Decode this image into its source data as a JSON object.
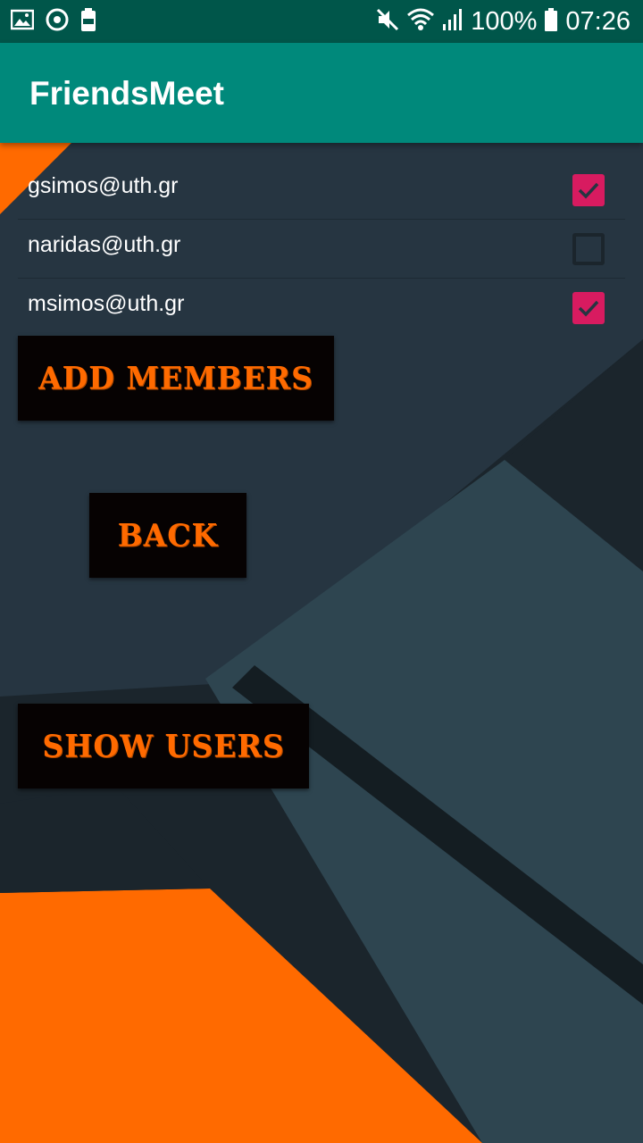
{
  "status_bar": {
    "battery_percent": "100%",
    "time": "07:26",
    "icons": [
      "gallery-icon",
      "sync-icon",
      "battery-saver-icon",
      "mute-icon",
      "wifi-icon",
      "signal-icon",
      "battery-icon"
    ]
  },
  "app_bar": {
    "title": "FriendsMeet"
  },
  "users": [
    {
      "email": "gsimos@uth.gr",
      "checked": true
    },
    {
      "email": "naridas@uth.gr",
      "checked": false
    },
    {
      "email": "msimos@uth.gr",
      "checked": true
    }
  ],
  "buttons": {
    "add_members": "ADD MEMBERS",
    "back": "BACK",
    "show_users": "SHOW USERS"
  },
  "colors": {
    "status_bar": "#00564a",
    "app_bar": "#00897b",
    "checkbox_checked": "#d81b60",
    "accent_orange": "#ff6a00",
    "button_bg": "#060202"
  }
}
